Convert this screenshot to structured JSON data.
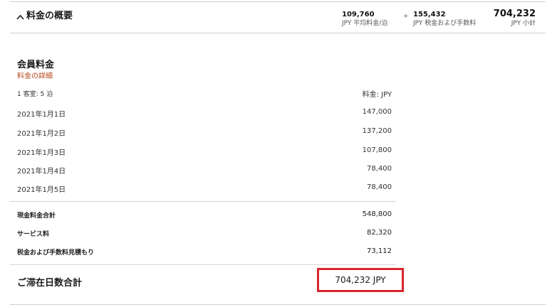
{
  "summary": {
    "title": "料金の概要",
    "metrics": [
      {
        "value": "109,760",
        "label": "JPY 平均料金/泊"
      },
      {
        "value": "155,432",
        "label": "JPY 税金および手数料"
      },
      {
        "value": "704,232",
        "label": "JPY 小計"
      }
    ],
    "plus_sign": "+"
  },
  "section": {
    "title": "会員料金",
    "details_link": "料金の詳細"
  },
  "stay": {
    "room_info": "1 客室: 5 泊",
    "rate_header": "料金: JPY",
    "nights": [
      {
        "date": "2021年1月1日",
        "amount": "147,000"
      },
      {
        "date": "2021年1月2日",
        "amount": "137,200"
      },
      {
        "date": "2021年1月3日",
        "amount": "107,800"
      },
      {
        "date": "2021年1月4日",
        "amount": "78,400"
      },
      {
        "date": "2021年1月5日",
        "amount": "78,400"
      }
    ]
  },
  "totals": [
    {
      "label": "現金料金合計",
      "amount": "548,800"
    },
    {
      "label": "サービス料",
      "amount": "82,320"
    },
    {
      "label": "税金および手数料見積もり",
      "amount": "73,112"
    }
  ],
  "grand_total": {
    "label": "ご滞在日数合計",
    "value": "704,232 JPY",
    "highlight_color": "#d8262d"
  },
  "colors": {
    "link": "#b6471a"
  }
}
